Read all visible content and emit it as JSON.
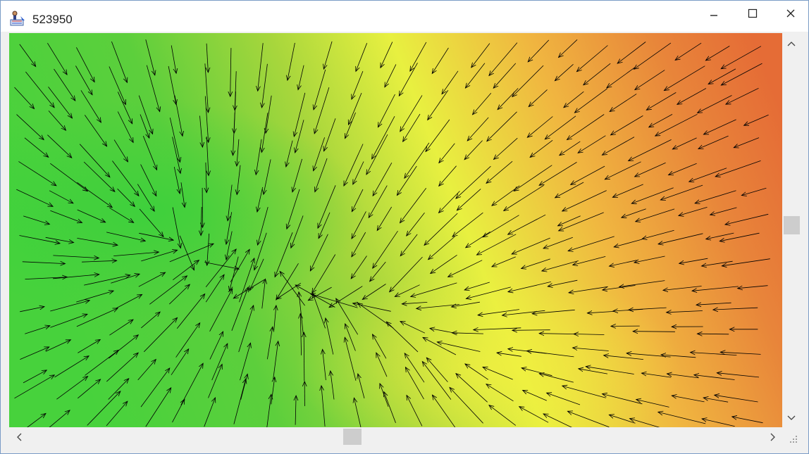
{
  "window": {
    "title": "523950",
    "icons": {
      "app": "map-tool-app-icon",
      "minimize": "minimize-icon",
      "maximize": "maximize-icon",
      "close": "close-icon"
    }
  },
  "map": {
    "description_colors": {
      "low_elevation": "#47d23c",
      "mid_elevation": "#e8f040",
      "high_elevation": "#e8743a"
    },
    "overlay": "flow-direction-arrows"
  },
  "scrollbars": {
    "vertical_position": 0.47,
    "horizontal_position": 0.45,
    "icons": {
      "up": "chevron-up-icon",
      "down": "chevron-down-icon",
      "left": "chevron-left-icon",
      "right": "chevron-right-icon",
      "grip": "resize-grip-icon"
    }
  }
}
